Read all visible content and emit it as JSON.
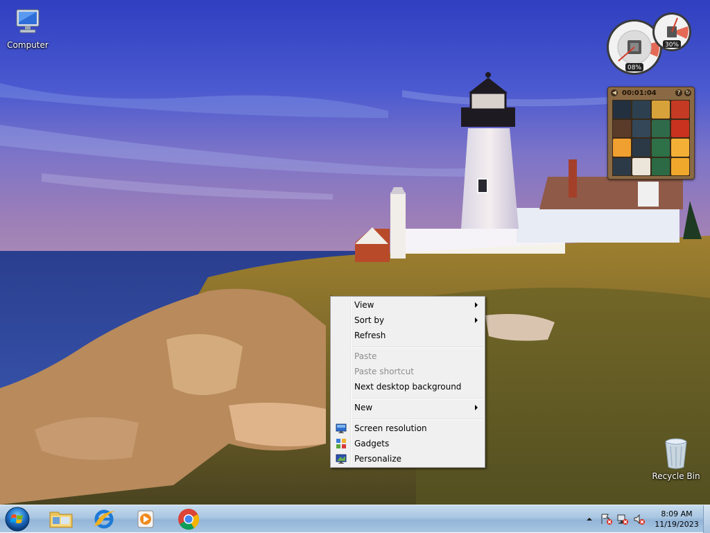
{
  "desktop": {
    "icons": [
      {
        "label": "Computer"
      },
      {
        "label": "Recycle Bin"
      }
    ]
  },
  "gadgets": {
    "cpu_meter": {
      "cpu_percent": "08%",
      "memory_percent": "30%"
    },
    "picture_puzzle": {
      "timer": "00:01:04"
    }
  },
  "context_menu": {
    "items": [
      {
        "label": "View",
        "submenu": true,
        "enabled": true
      },
      {
        "label": "Sort by",
        "submenu": true,
        "enabled": true
      },
      {
        "label": "Refresh",
        "submenu": false,
        "enabled": true
      },
      {
        "label": "Paste",
        "submenu": false,
        "enabled": false
      },
      {
        "label": "Paste shortcut",
        "submenu": false,
        "enabled": false
      },
      {
        "label": "Next desktop background",
        "submenu": false,
        "enabled": true
      },
      {
        "label": "New",
        "submenu": true,
        "enabled": true
      },
      {
        "label": "Screen resolution",
        "submenu": false,
        "enabled": true,
        "icon": "display-icon"
      },
      {
        "label": "Gadgets",
        "submenu": false,
        "enabled": true,
        "icon": "gadgets-icon"
      },
      {
        "label": "Personalize",
        "submenu": false,
        "enabled": true,
        "icon": "personalize-icon"
      }
    ]
  },
  "taskbar": {
    "pinned": [
      "start-orb-icon",
      "file-explorer-icon",
      "internet-explorer-icon",
      "media-player-icon",
      "chrome-icon"
    ],
    "tray_icons": [
      "show-hidden-icons-icon",
      "action-center-icon",
      "network-icon",
      "volume-muted-icon"
    ],
    "clock": {
      "time": "8:09 AM",
      "date": "11/19/2023"
    }
  },
  "colors": {
    "taskbar": "#a8c5e1",
    "menu_background": "#f0f0f0",
    "disabled_text": "#8d8d8d"
  }
}
